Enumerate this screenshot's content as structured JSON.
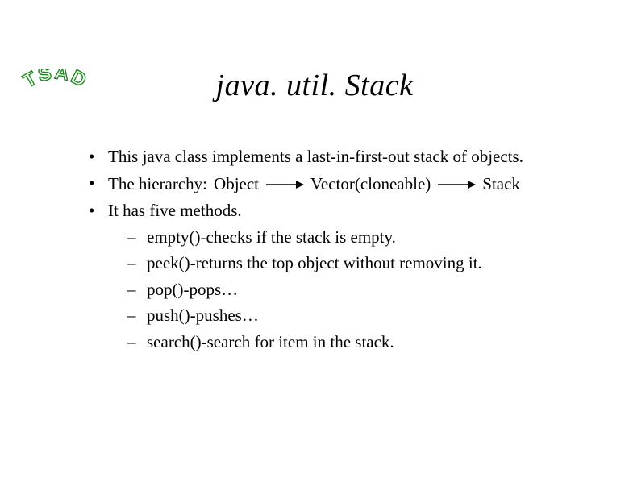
{
  "logo": {
    "text": "TSAD"
  },
  "title": "java. util. Stack",
  "bullets": [
    {
      "text": "This java class implements a last-in-first-out stack of objects."
    },
    {
      "prefix": "The hierarchy: ",
      "chain": [
        "Object",
        "Vector(cloneable)",
        "Stack"
      ]
    },
    {
      "text": "It has five methods.",
      "sub": [
        "empty()-checks if the stack is empty.",
        "peek()-returns the top object without removing it.",
        "pop()-pops…",
        "push()-pushes…",
        "search()-search for item in the stack."
      ]
    }
  ]
}
